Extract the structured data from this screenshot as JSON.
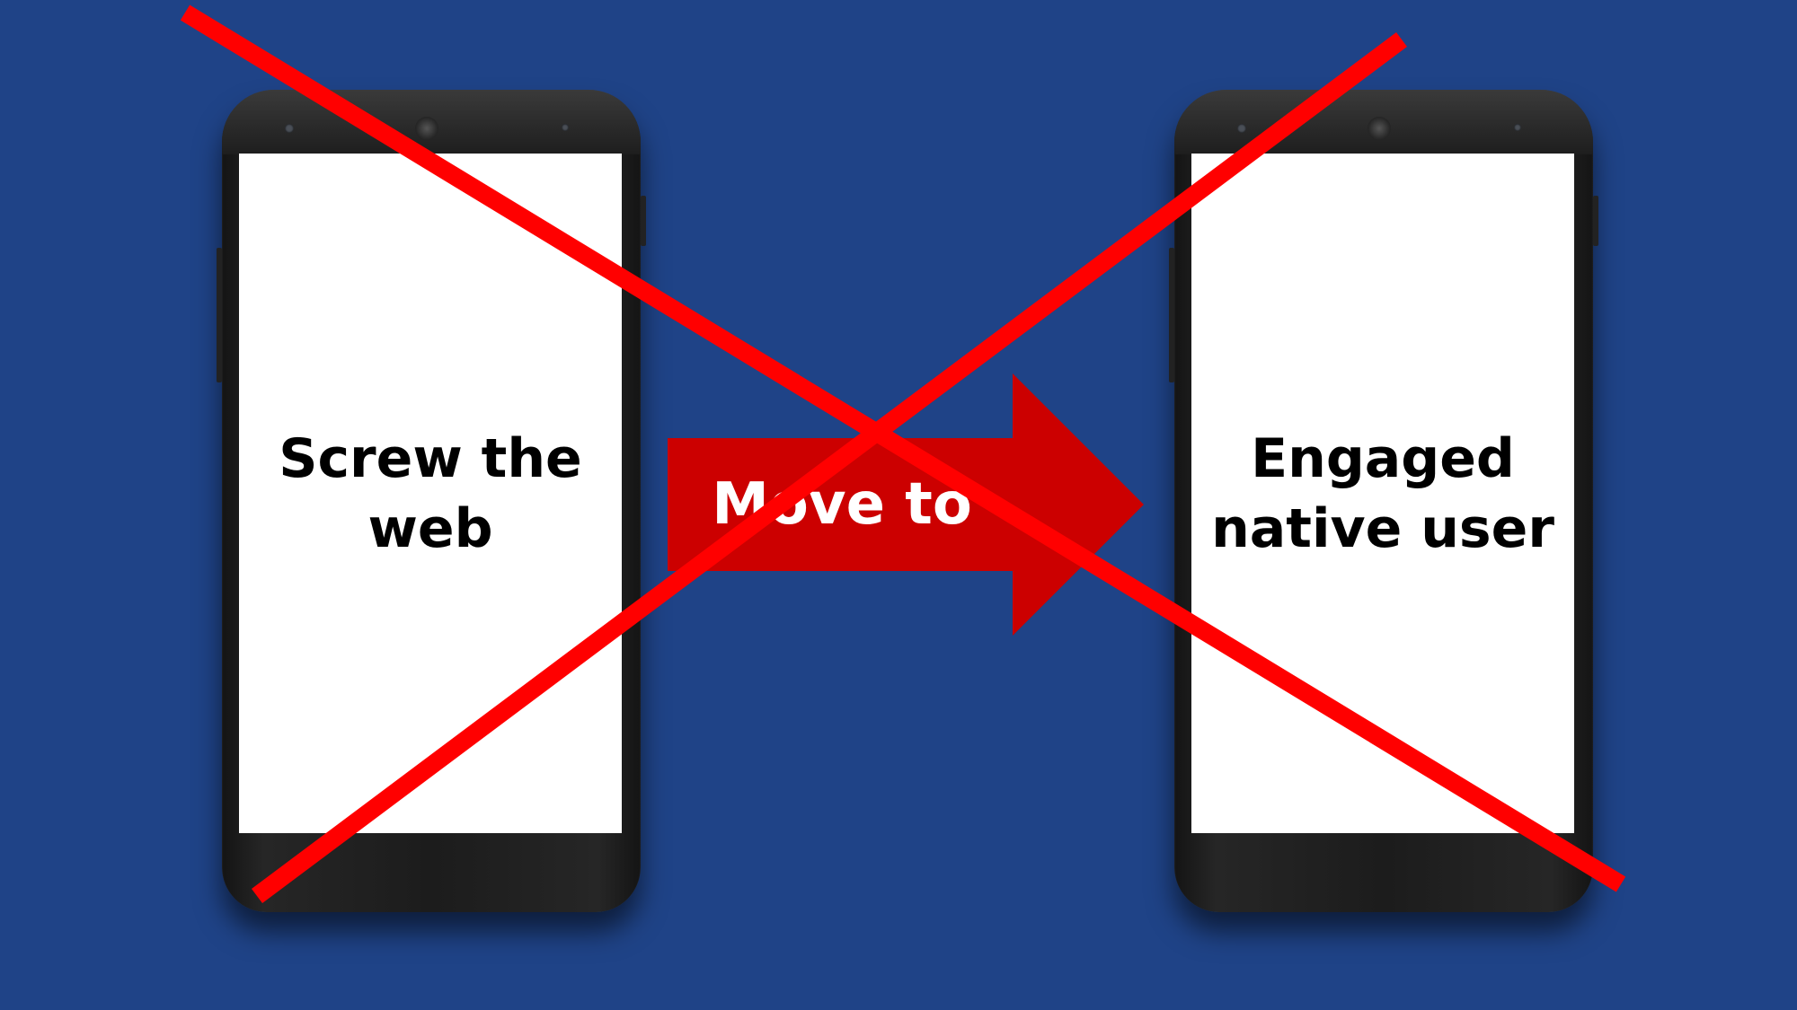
{
  "left_phone": {
    "line1": "Screw the",
    "line2": "web"
  },
  "arrow": {
    "label": "Move to",
    "color": "#cc0000"
  },
  "right_phone": {
    "line1": "Engaged",
    "line2": "native user"
  },
  "colors": {
    "background": "#1f4387",
    "cross": "#ff0000",
    "screen": "#ffffff"
  }
}
